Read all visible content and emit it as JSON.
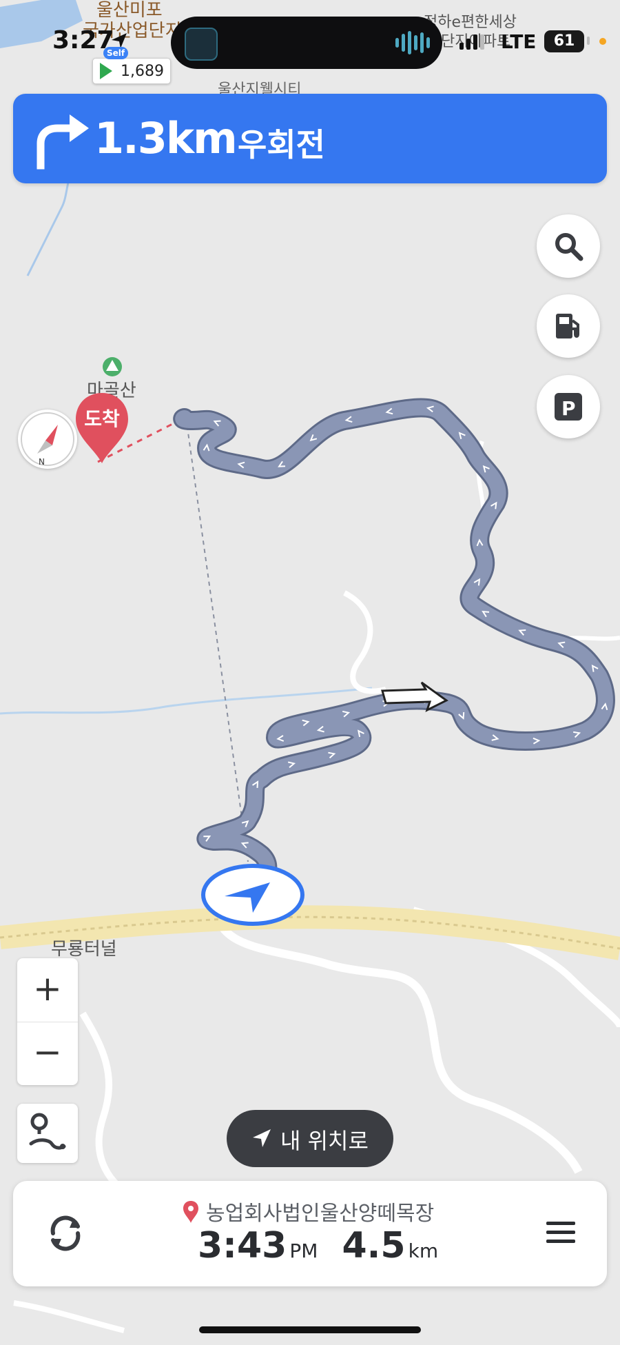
{
  "status_bar": {
    "time": "3:27",
    "network": "LTE",
    "battery": "61"
  },
  "gas_station": {
    "badge": "Self",
    "price": "1,689"
  },
  "map_labels": {
    "top_left_1": "울산미포",
    "top_left_2": "국가산업단지",
    "top_right_1": "정하e편한세상",
    "top_right_2": "단지아파트",
    "top_center": "울산지웰시티",
    "tunnel": "무룡터널",
    "peak": "마골산"
  },
  "navigation": {
    "distance": "1.3km",
    "instruction": "우회전"
  },
  "destination_marker": {
    "label": "도착"
  },
  "compass": {
    "north": "N"
  },
  "zoom": {
    "plus": "+",
    "minus": "−"
  },
  "my_location_button": {
    "label": "내 위치로"
  },
  "trip": {
    "destination": "농업회사법인울산양떼목장",
    "eta_time": "3:43",
    "eta_suffix": "PM",
    "distance_value": "4.5",
    "distance_unit": "km"
  },
  "colors": {
    "banner": "#3577f0",
    "route": "#8794b3",
    "destination": "#e0505e",
    "map_bg": "#e8e8e8"
  },
  "icons": {
    "search": "search-icon",
    "fuel": "fuel-icon",
    "parking": "parking-icon",
    "parking_letter": "P",
    "refresh": "refresh-icon",
    "menu": "menu-icon",
    "route": "route-icon",
    "location": "location-arrow-icon",
    "turn": "turn-right-arrow-icon"
  }
}
